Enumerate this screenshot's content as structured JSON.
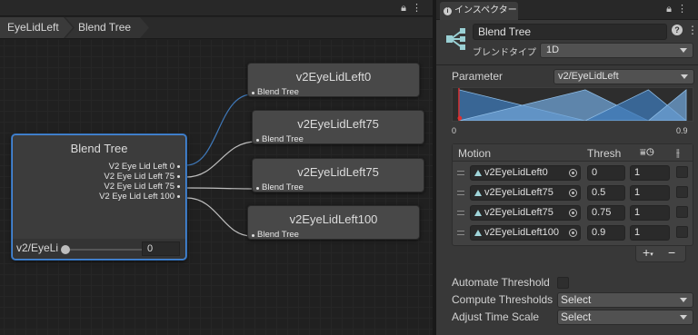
{
  "animator": {
    "breadcrumb": [
      "EyeLidLeft",
      "Blend Tree"
    ],
    "blend_tree_node": {
      "title": "Blend Tree",
      "ports": [
        "V2 Eye Lid Left 0",
        "V2 Eye Lid Left 75",
        "V2 Eye Lid Left 75",
        "V2 Eye Lid Left 100"
      ],
      "parameter": "v2/EyeLi",
      "value": "0"
    },
    "child_nodes": [
      {
        "title": "v2EyeLidLeft0",
        "port": "Blend Tree"
      },
      {
        "title": "v2EyeLidLeft75",
        "port": "Blend Tree"
      },
      {
        "title": "v2EyeLidLeft75",
        "port": "Blend Tree"
      },
      {
        "title": "v2EyeLidLeft100",
        "port": "Blend Tree"
      }
    ],
    "header_icons": [
      "lock-icon",
      "more-icon"
    ]
  },
  "inspector": {
    "tab_label": "インスペクター",
    "header_icons": [
      "lock-icon",
      "more-icon"
    ],
    "asset_name": "Blend Tree",
    "blend_type_label": "ブレンドタイプ",
    "blend_type_value": "1D",
    "parameter_label": "Parameter",
    "parameter_value": "v2/EyeLidLeft",
    "graph": {
      "min": "0",
      "max": "0.9",
      "thresholds": [
        0,
        0.5,
        0.75,
        0.9
      ],
      "range": [
        0,
        0.9
      ]
    },
    "motion_table": {
      "headers": {
        "motion": "Motion",
        "threshold": "Thresh",
        "speed_icon": "clock-speed-icon",
        "mirror_icon": "mirror-icon"
      },
      "rows": [
        {
          "motion": "v2EyeLidLeft0",
          "threshold": "0",
          "speed": "1"
        },
        {
          "motion": "v2EyeLidLeft75",
          "threshold": "0.5",
          "speed": "1"
        },
        {
          "motion": "v2EyeLidLeft75",
          "threshold": "0.75",
          "speed": "1"
        },
        {
          "motion": "v2EyeLidLeft100",
          "threshold": "0.9",
          "speed": "1"
        }
      ],
      "add_label": "+",
      "remove_label": "−"
    },
    "automate_threshold_label": "Automate Threshold",
    "compute_thresholds_label": "Compute Thresholds",
    "compute_thresholds_value": "Select",
    "adjust_time_scale_label": "Adjust Time Scale",
    "adjust_time_scale_value": "Select",
    "colors": {
      "accent": "#4a8ad8",
      "graph_fill": "#3d7ab8",
      "graph_fill_light": "#6fa3d6"
    }
  }
}
